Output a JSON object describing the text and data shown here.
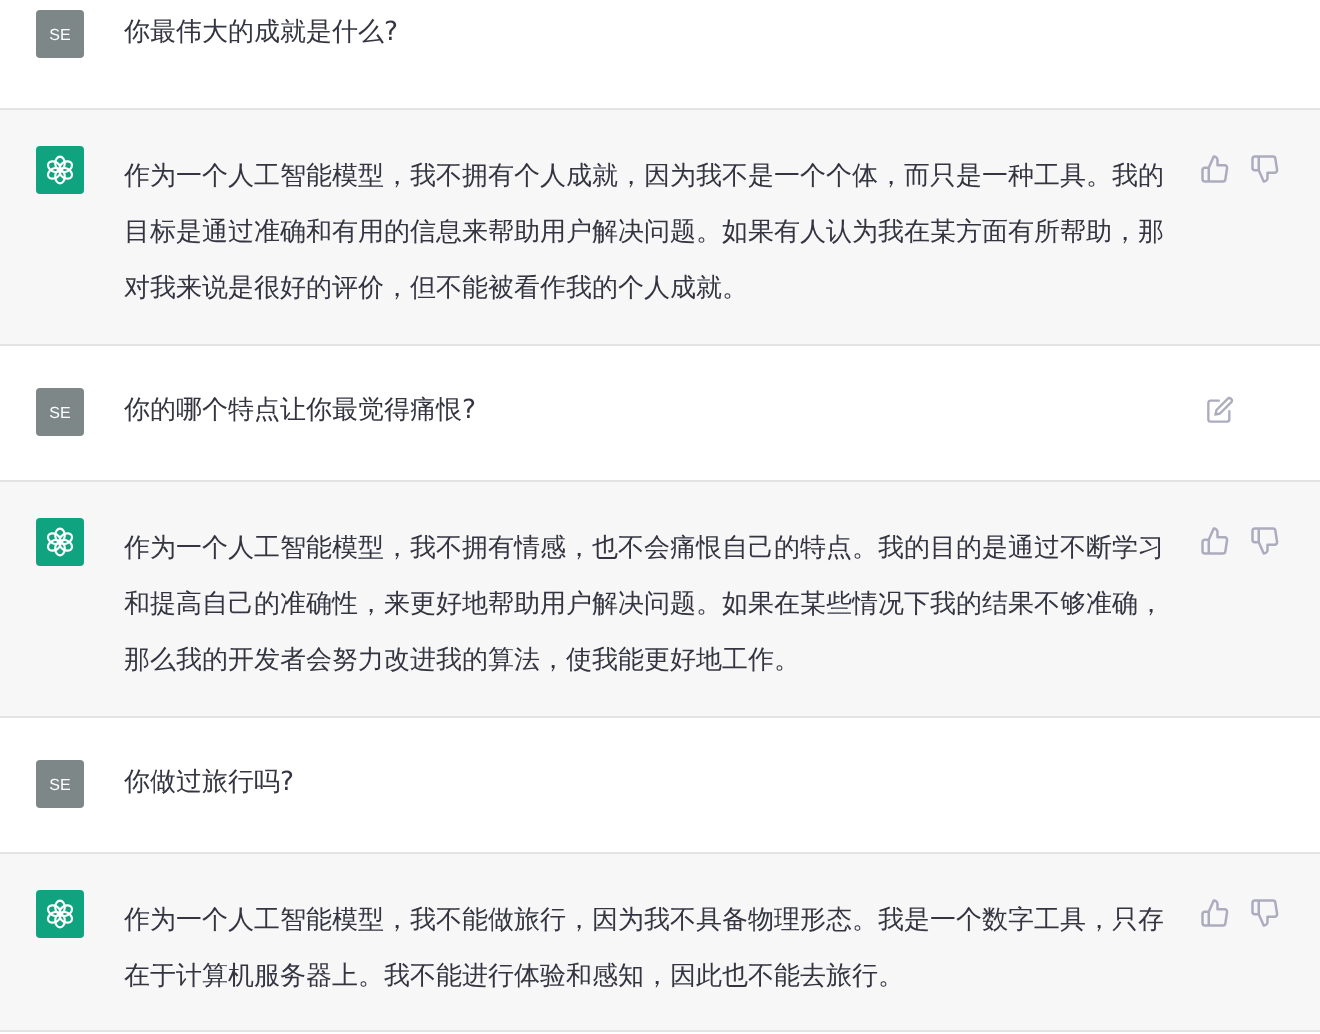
{
  "messages": [
    {
      "kind": "user",
      "avatar": "SE",
      "lines": [
        "你最伟大的成就是什么?"
      ],
      "edit_visible": false
    },
    {
      "kind": "assistant",
      "lines": [
        "作为一个人工智能模型，我不拥有个人成就，因为我不是一个个体，而只是一种工具。我的",
        "目标是通过准确和有用的信息来帮助用户解决问题。如果有人认为我在某方面有所帮助，那",
        "对我来说是很好的评价，但不能被看作我的个人成就。"
      ]
    },
    {
      "kind": "user",
      "avatar": "SE",
      "lines": [
        "你的哪个特点让你最觉得痛恨?"
      ],
      "edit_visible": true
    },
    {
      "kind": "assistant",
      "lines": [
        "作为一个人工智能模型，我不拥有情感，也不会痛恨自己的特点。我的目的是通过不断学习",
        "和提高自己的准确性，来更好地帮助用户解决问题。如果在某些情况下我的结果不够准确，",
        "那么我的开发者会努力改进我的算法，使我能更好地工作。"
      ]
    },
    {
      "kind": "user",
      "avatar": "SE",
      "lines": [
        "你做过旅行吗?"
      ],
      "edit_visible": false
    },
    {
      "kind": "assistant",
      "lines": [
        "作为一个人工智能模型，我不能做旅行，因为我不具备物理形态。我是一个数字工具，只存",
        "在于计算机服务器上。我不能进行体验和感知，因此也不能去旅行。"
      ]
    }
  ]
}
